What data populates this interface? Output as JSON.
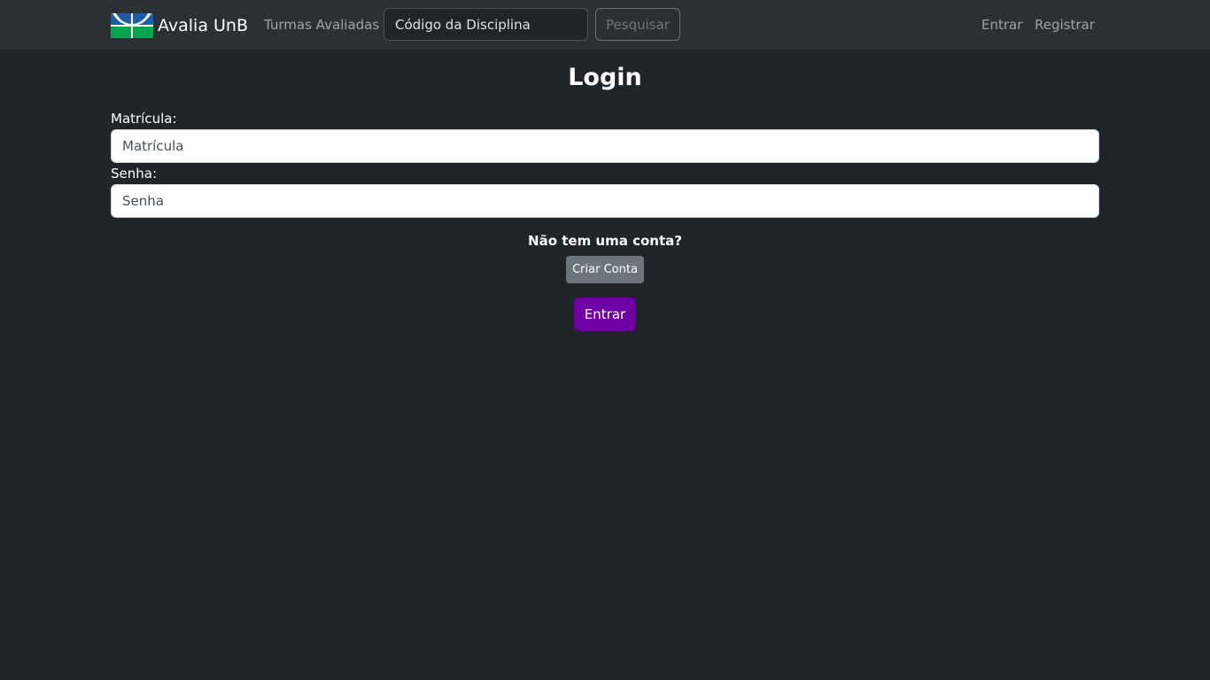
{
  "navbar": {
    "brand": "Avalia UnB",
    "logo_icon": "unb-logo-icon",
    "links": {
      "turmas": "Turmas Avaliadas",
      "entrar": "Entrar",
      "registrar": "Registrar"
    },
    "search": {
      "placeholder": "Código da Disciplina",
      "button_label": "Pesquisar"
    }
  },
  "login": {
    "title": "Login",
    "matricula_label": "Matrícula:",
    "matricula_placeholder": "Matrícula",
    "senha_label": "Senha:",
    "senha_placeholder": "Senha",
    "no_account_text": "Não tem uma conta?",
    "create_account_label": "Criar Conta",
    "submit_label": "Entrar"
  },
  "colors": {
    "background": "#212529",
    "navbar": "#2b3035",
    "primary_button": "#6f00a6",
    "secondary_button": "#6c757d",
    "logo_blue": "#1f5ba8",
    "logo_green": "#00a550"
  }
}
